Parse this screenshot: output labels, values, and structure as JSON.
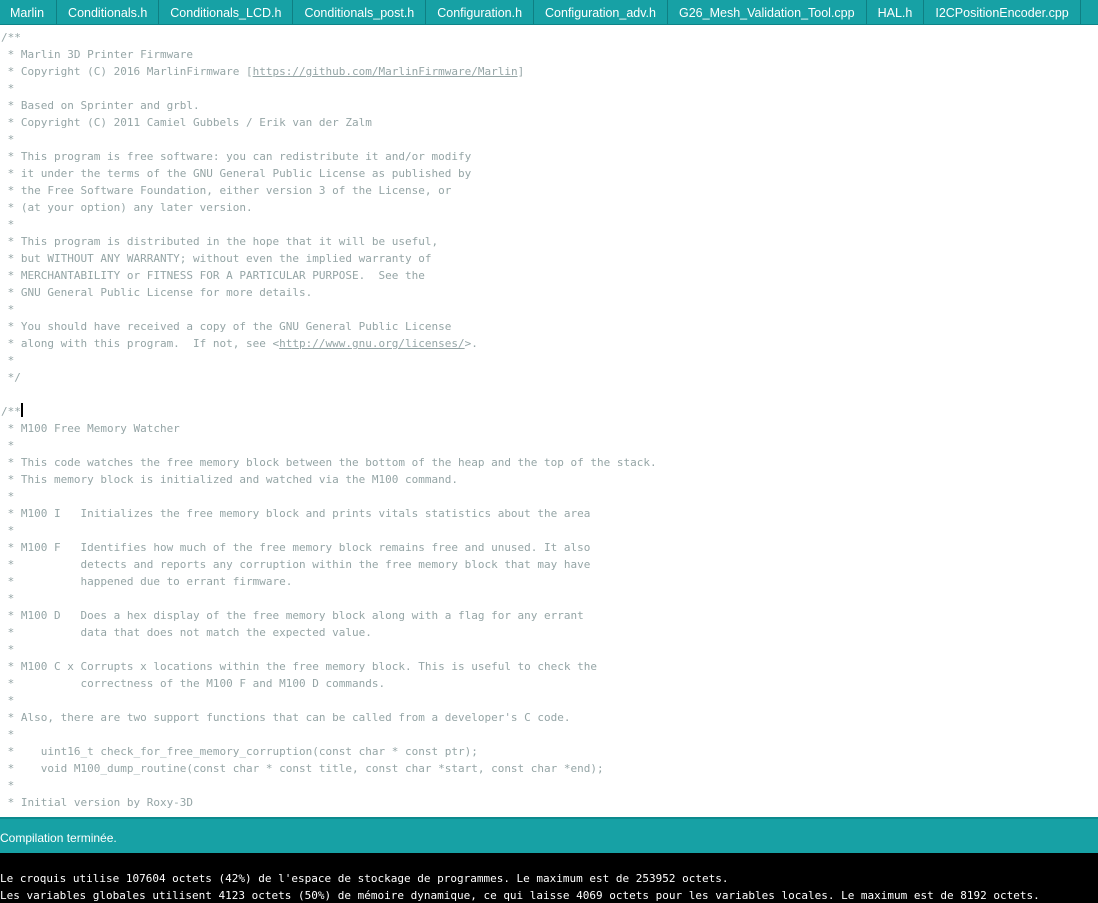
{
  "tabs": [
    "Marlin",
    "Conditionals.h",
    "Conditionals_LCD.h",
    "Conditionals_post.h",
    "Configuration.h",
    "Configuration_adv.h",
    "G26_Mesh_Validation_Tool.cpp",
    "HAL.h",
    "I2CPositionEncoder.cpp"
  ],
  "colors": {
    "accent": "#17a1a5",
    "comment": "#95a5a6",
    "console_bg": "#000000",
    "console_text": "#ffffff"
  },
  "code_lines": [
    "/**",
    " * Marlin 3D Printer Firmware",
    " * Copyright (C) 2016 MarlinFirmware [https://github.com/MarlinFirmware/Marlin]",
    " *",
    " * Based on Sprinter and grbl.",
    " * Copyright (C) 2011 Camiel Gubbels / Erik van der Zalm",
    " *",
    " * This program is free software: you can redistribute it and/or modify",
    " * it under the terms of the GNU General Public License as published by",
    " * the Free Software Foundation, either version 3 of the License, or",
    " * (at your option) any later version.",
    " *",
    " * This program is distributed in the hope that it will be useful,",
    " * but WITHOUT ANY WARRANTY; without even the implied warranty of",
    " * MERCHANTABILITY or FITNESS FOR A PARTICULAR PURPOSE.  See the",
    " * GNU General Public License for more details.",
    " *",
    " * You should have received a copy of the GNU General Public License",
    " * along with this program.  If not, see <http://www.gnu.org/licenses/>.",
    " *",
    " */",
    "",
    "/**",
    " * M100 Free Memory Watcher",
    " *",
    " * This code watches the free memory block between the bottom of the heap and the top of the stack.",
    " * This memory block is initialized and watched via the M100 command.",
    " *",
    " * M100 I   Initializes the free memory block and prints vitals statistics about the area",
    " *",
    " * M100 F   Identifies how much of the free memory block remains free and unused. It also",
    " *          detects and reports any corruption within the free memory block that may have",
    " *          happened due to errant firmware.",
    " *",
    " * M100 D   Does a hex display of the free memory block along with a flag for any errant",
    " *          data that does not match the expected value.",
    " *",
    " * M100 C x Corrupts x locations within the free memory block. This is useful to check the",
    " *          correctness of the M100 F and M100 D commands.",
    " *",
    " * Also, there are two support functions that can be called from a developer's C code.",
    " *",
    " *    uint16_t check_for_free_memory_corruption(const char * const ptr);",
    " *    void M100_dump_routine(const char * const title, const char *start, const char *end);",
    " *",
    " * Initial version by Roxy-3D"
  ],
  "urls": [
    "https://github.com/MarlinFirmware/Marlin",
    "http://www.gnu.org/licenses/"
  ],
  "status": {
    "text": "Compilation terminée."
  },
  "console": [
    "Le croquis utilise 107604 octets (42%) de l'espace de stockage de programmes. Le maximum est de 253952 octets.",
    "Les variables globales utilisent 4123 octets (50%) de mémoire dynamique, ce qui laisse 4069 octets pour les variables locales. Le maximum est de 8192 octets."
  ]
}
